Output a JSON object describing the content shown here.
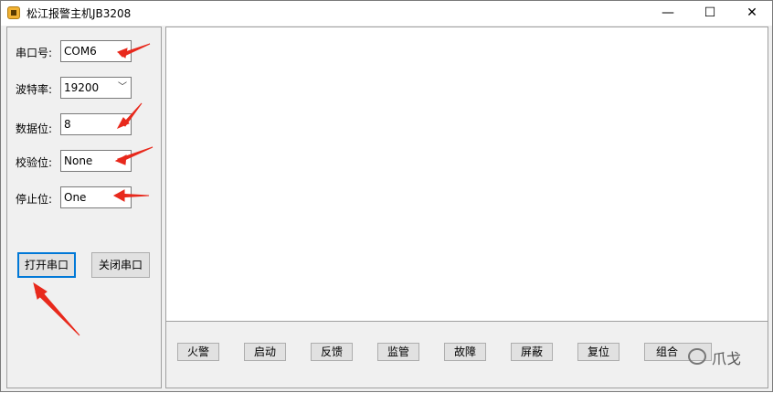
{
  "window": {
    "title": "松江报警主机JB3208",
    "minimize": "—",
    "maximize": "☐",
    "close": "✕"
  },
  "settings": {
    "port_label": "串口号:",
    "port_value": "COM6",
    "baud_label": "波特率:",
    "baud_value": "19200",
    "databits_label": "数据位:",
    "databits_value": "8",
    "parity_label": "校验位:",
    "parity_value": "None",
    "stopbits_label": "停止位:",
    "stopbits_value": "One"
  },
  "actions": {
    "open_port": "打开串口",
    "close_port": "关闭串口"
  },
  "commands": [
    "火警",
    "启动",
    "反馈",
    "监管",
    "故障",
    "屏蔽",
    "复位",
    "组合"
  ],
  "watermark": "爪戈",
  "colors": {
    "arrow": "#e8291c",
    "focus": "#0078d7"
  }
}
